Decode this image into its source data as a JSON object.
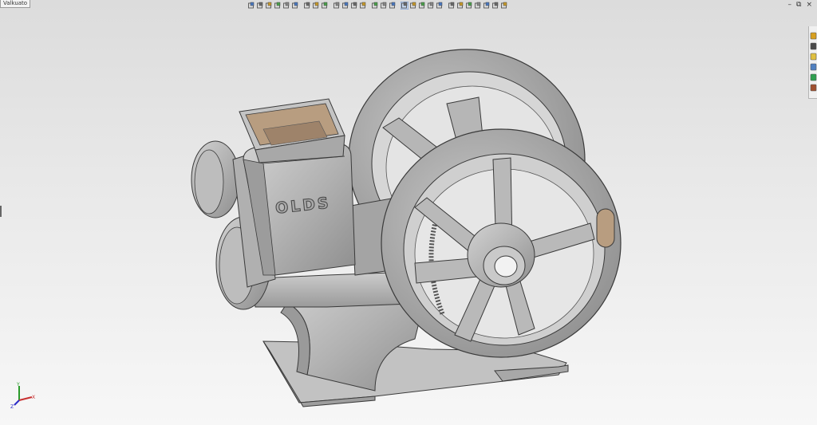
{
  "window": {
    "doc_tab_label": "Valkuato",
    "minimize_glyph": "–",
    "restore_glyph": "⧉",
    "close_glyph": "×"
  },
  "toolbar": {
    "buttons": [
      {
        "icon": "zoom-to-fit-icon"
      },
      {
        "icon": "zoom-to-area-icon"
      },
      {
        "icon": "previous-view-icon"
      },
      {
        "icon": "section-view-icon"
      },
      {
        "icon": "dynamic-annotation-icon"
      },
      {
        "icon": "sketch-pencil-icon"
      },
      {
        "icon": "zoom-icon"
      },
      {
        "icon": "zoom-in-out-icon"
      },
      {
        "icon": "rotate-view-icon"
      },
      {
        "icon": "display-pane-icon"
      },
      {
        "icon": "view-orientation-icon"
      },
      {
        "icon": "display-style-icon"
      },
      {
        "icon": "hide-show-items-icon"
      },
      {
        "icon": "edit-appearance-icon"
      },
      {
        "icon": "apply-scene-icon"
      },
      {
        "icon": "view-settings-icon"
      },
      {
        "icon": "shaded-with-edges-icon"
      },
      {
        "icon": "shaded-icon"
      },
      {
        "icon": "hidden-lines-removed-icon"
      },
      {
        "icon": "hidden-lines-visible-icon"
      },
      {
        "icon": "wireframe-icon"
      },
      {
        "icon": "perspective-icon"
      },
      {
        "icon": "shadows-icon"
      },
      {
        "icon": "ambient-occlusion-icon"
      },
      {
        "icon": "realview-icon"
      },
      {
        "icon": "cartoon-icon"
      },
      {
        "icon": "view-cube-icon"
      },
      {
        "icon": "isometric-view-icon"
      }
    ]
  },
  "task_pane": {
    "tabs": [
      {
        "icon": "resources-icon"
      },
      {
        "icon": "design-library-icon"
      },
      {
        "icon": "file-explorer-icon"
      },
      {
        "icon": "view-palette-icon"
      },
      {
        "icon": "appearances-icon"
      },
      {
        "icon": "custom-properties-icon"
      }
    ]
  },
  "model": {
    "engraving": "OLDS"
  },
  "triad": {
    "x_label": "X",
    "y_label": "Y",
    "z_label": "Z"
  },
  "colors": {
    "metal": "#b4b4b4",
    "metal_dark": "#8a8a8a",
    "edge": "#3a3a3a",
    "hopper_inside": "#b89d80",
    "triad_x": "#c83232",
    "triad_y": "#2a9a2a",
    "triad_z": "#2a2ac8"
  }
}
